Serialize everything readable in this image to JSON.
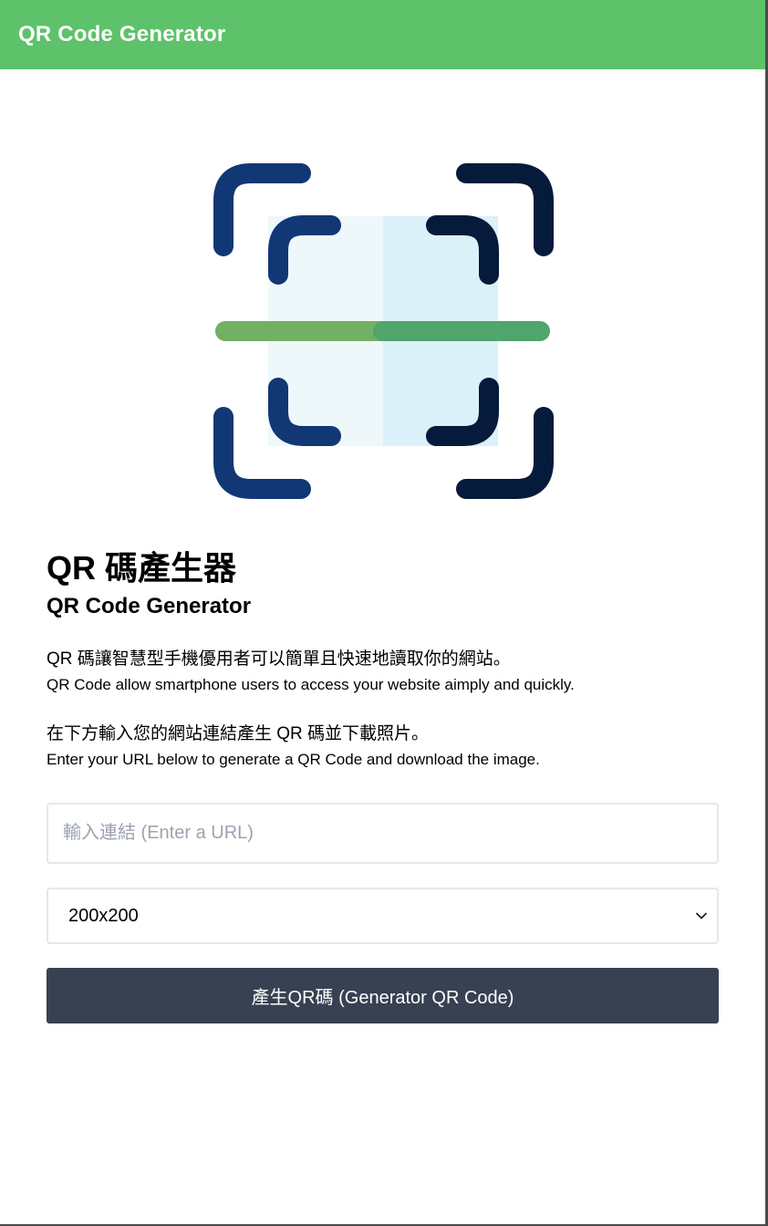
{
  "header": {
    "title": "QR Code Generator"
  },
  "hero": {
    "icon": "qr-scan-icon"
  },
  "main": {
    "title_zh": "QR 碼產生器",
    "title_en": "QR Code Generator",
    "desc1_zh": "QR 碼讓智慧型手機優用者可以簡單且快速地讀取你的網站。",
    "desc1_en": "QR Code allow smartphone users to access your website aimply and quickly.",
    "desc2_zh": "在下方輸入您的網站連結產生 QR 碼並下載照片。",
    "desc2_en": "Enter your URL below to generate a QR Code and download the image."
  },
  "form": {
    "url_value": "",
    "url_placeholder": "輸入連結 (Enter a URL)",
    "size_selected": "200x200",
    "button_label": "產生QR碼 (Generator QR Code)"
  },
  "colors": {
    "header_bg": "#5ec26a",
    "button_bg": "#374151",
    "frame_blue": "#123775",
    "frame_navy": "#061a3b",
    "scan_line_green": "#74b063"
  }
}
